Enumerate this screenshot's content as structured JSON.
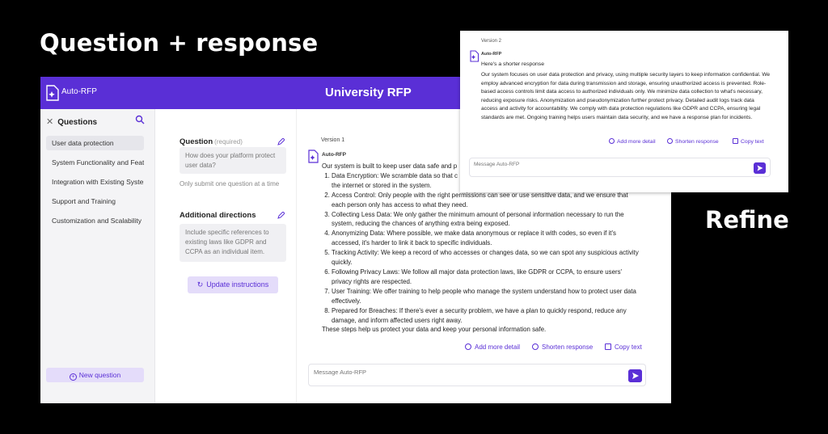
{
  "hero": {
    "left": "Question + response",
    "right": "Refine"
  },
  "app": {
    "brand": "Auto-RFP",
    "title": "University RFP"
  },
  "sidebar": {
    "title": "Questions",
    "items": [
      {
        "label": "User data protection"
      },
      {
        "label": "System Functionality and Featu"
      },
      {
        "label": "Integration with Existing System"
      },
      {
        "label": "Support and Training"
      },
      {
        "label": "Customization and Scalability"
      }
    ],
    "new_question": "New question"
  },
  "form": {
    "question_label": "Question",
    "question_required": "(required)",
    "question_value": "How does your platform protect user data?",
    "question_hint": "Only submit one question at a time",
    "directions_label": "Additional directions",
    "directions_value": "Include specific references to existing laws like GDPR and CCPA as an individual item.",
    "update_button": "Update instructions"
  },
  "chat": {
    "version": "Version 1",
    "bot_name": "Auto-RFP",
    "intro": "Our system is built to keep user data safe and p",
    "items": [
      "Data Encryption: We scramble data so that c",
      "Access Control: Only people with the right permissions can see or use sensitive data, and we ensure that each person only has access to what they need.",
      "Collecting Less Data: We only gather the minimum amount of personal information necessary to run the system, reducing the chances of anything extra being exposed.",
      "Anonymizing Data: Where possible, we make data anonymous or replace it with codes, so even if it's accessed, it's harder to link it back to specific individuals.",
      "Tracking Activity: We keep a record of who accesses or changes data, so we can spot any suspicious activity quickly.",
      "Following Privacy Laws: We follow all major data protection laws, like GDPR or CCPA, to ensure users' privacy rights are respected.",
      "User Training: We offer training to help people who manage the system understand how to protect user data effectively.",
      "Prepared for Breaches: If there's ever a security problem, we have a plan to quickly respond, reduce any damage, and inform affected users right away."
    ],
    "item1_cont": "the internet or stored in the system.",
    "outro": "These steps help us protect your data and keep your personal information safe.",
    "action_more": "Add more detail",
    "action_shorten": "Shorten response",
    "action_copy": "Copy text",
    "placeholder": "Message Auto-RFP"
  },
  "refine": {
    "version": "Version 2",
    "bot_name": "Auto-RFP",
    "short": "Here's a shorter response",
    "body": "Our system focuses on user data protection and privacy, using multiple security layers to keep information confidential. We employ advanced encryption for data during transmission and storage, ensuring unauthorized access is prevented. Role-based access controls limit data access to authorized individuals only. We minimize data collection to what's necessary, reducing exposure risks. Anonymization and pseudonymization further protect privacy. Detailed audit logs track data access and activity for accountability. We comply with data protection regulations like GDPR and CCPA, ensuring legal standards are met. Ongoing training helps users maintain data security, and we have a response plan for incidents.",
    "action_more": "Add more detail",
    "action_shorten": "Shorten response",
    "action_copy": "Copy text",
    "placeholder": "Message Auto-RFP"
  },
  "colors": {
    "brand": "#5a2fd6",
    "accent_light": "#e4dcfa"
  },
  "icons": [
    "logo-icon",
    "close-icon",
    "search-icon",
    "pencil-icon",
    "refresh-icon",
    "plus-icon",
    "send-icon",
    "copy-icon"
  ]
}
